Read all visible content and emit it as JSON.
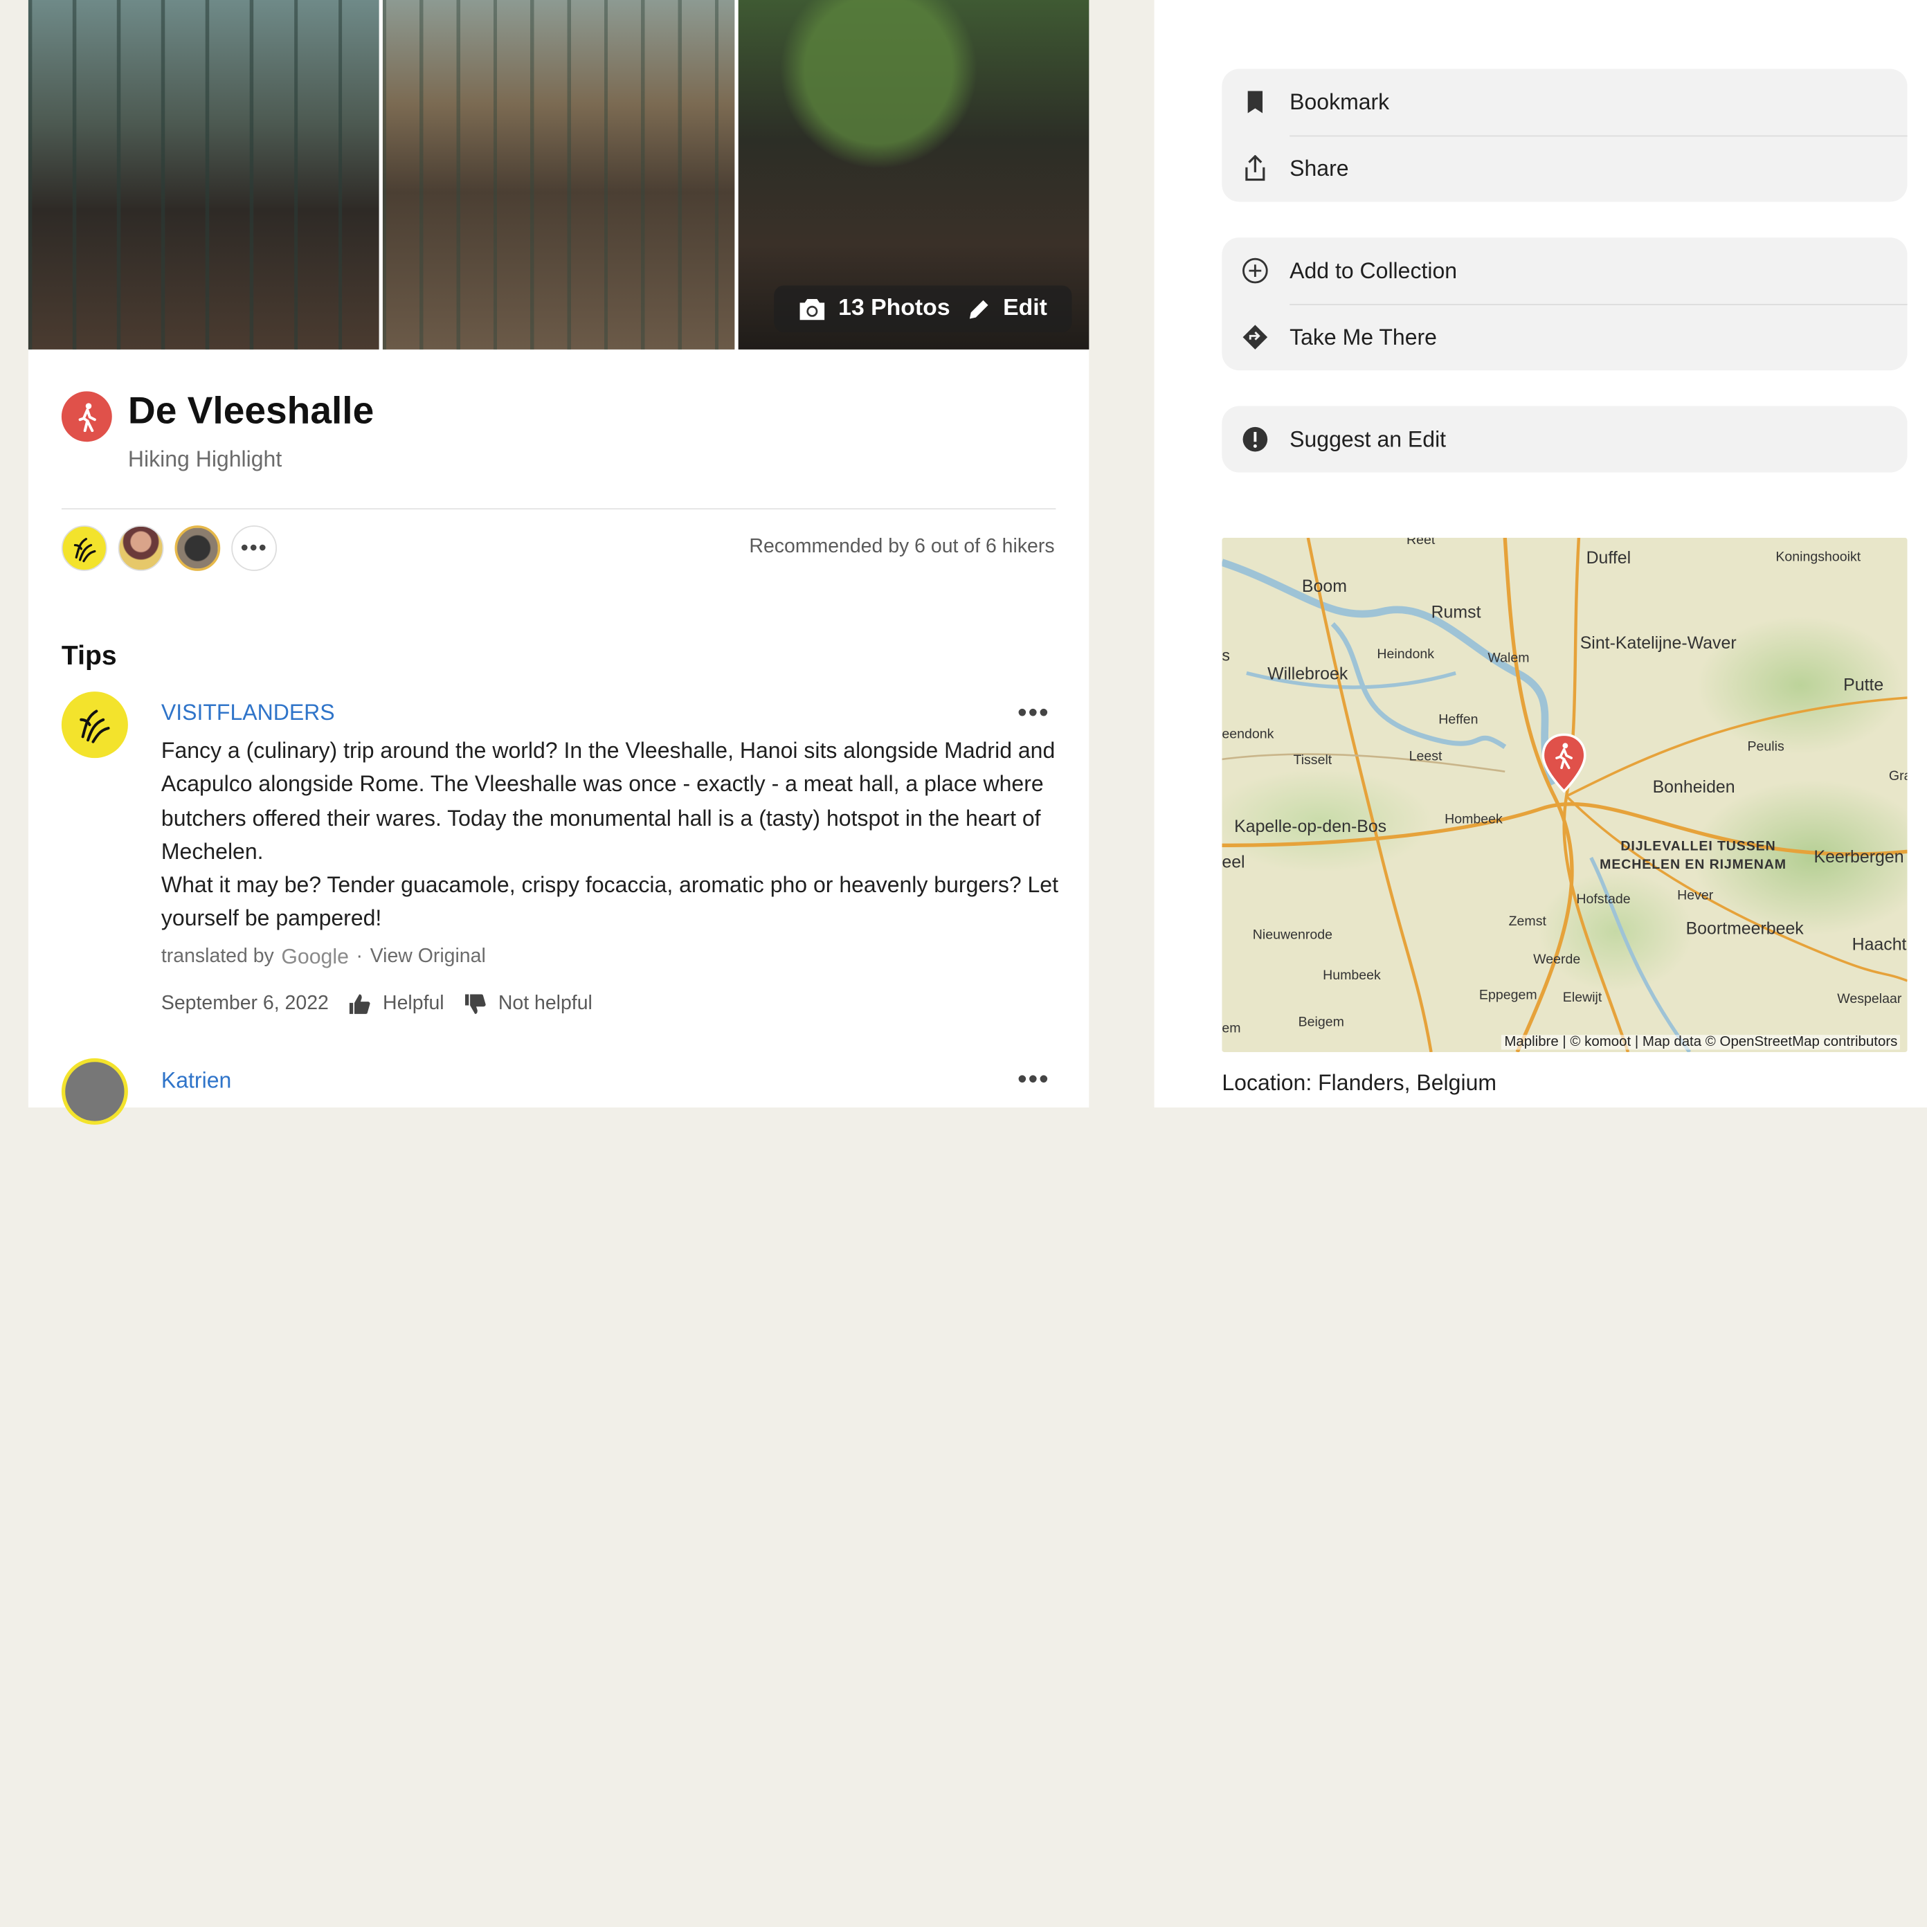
{
  "photos": {
    "count_label": "13 Photos",
    "edit_label": "Edit"
  },
  "highlight": {
    "title": "De Vleeshalle",
    "subtitle": "Hiking Highlight",
    "recommended": "Recommended by 6 out of 6 hikers"
  },
  "tips": {
    "heading": "Tips",
    "items": [
      {
        "author": "VISITFLANDERS",
        "body_1": "Fancy a (culinary) trip around the world? In the Vleeshalle, Hanoi sits alongside Madrid and Acapulco alongside Rome. The Vleeshalle was once - exactly - a meat hall, a place where butchers offered their wares. Today the monumental hall is a (tasty) hotspot in the heart of Mechelen.",
        "body_2": "What it may be? Tender guacamole, crispy focaccia, aromatic pho or heavenly burgers? Let yourself be pampered!",
        "translated_by": "translated by",
        "translator": "Google",
        "view_original": "View Original",
        "date": "September 6, 2022",
        "helpful": "Helpful",
        "not_helpful": "Not helpful"
      },
      {
        "author": "Katrien"
      }
    ]
  },
  "actions": {
    "bookmark": "Bookmark",
    "share": "Share",
    "add_to_collection": "Add to Collection",
    "take_me_there": "Take Me There",
    "suggest_edit": "Suggest an Edit"
  },
  "map": {
    "labels": {
      "reet": "Reet",
      "duffel": "Duffel",
      "koningshooikt": "Koningshooikt",
      "boom": "Boom",
      "rumst": "Rumst",
      "sint_katelijne": "Sint-Katelijne-Waver",
      "heindonk": "Heindonk",
      "walem": "Walem",
      "s": "s",
      "willebroek": "Willebroek",
      "putte": "Putte",
      "heffen": "Heffen",
      "eendonk": "eendonk",
      "peulis": "Peulis",
      "tisselt": "Tisselt",
      "leest": "Leest",
      "gra": "Gra",
      "bonheiden": "Bonheiden",
      "hombeek": "Hombeek",
      "kapelle": "Kapelle-op-den-Bos",
      "dijlevallei_1": "DIJLEVALLEI TUSSEN",
      "dijlevallei_2": "MECHELEN EN RIJMENAM",
      "keerbergen": "Keerbergen",
      "eel": "eel",
      "hofstade": "Hofstade",
      "hever": "Hever",
      "zemst": "Zemst",
      "boortmeerbeek": "Boortmeerbeek",
      "nieuwenrode": "Nieuwenrode",
      "haacht": "Haacht",
      "weerde": "Weerde",
      "humbeek": "Humbeek",
      "eppegem": "Eppegem",
      "elewijt": "Elewijt",
      "wespelaar": "Wespelaar",
      "em": "em",
      "beigem": "Beigem"
    },
    "attribution": "Maplibre | © komoot | Map data © OpenStreetMap contributors"
  },
  "location": "Location: Flanders, Belgium",
  "colors": {
    "sport": "#e0514a",
    "link": "#2f74c9",
    "visitflanders": "#f3e32c"
  }
}
